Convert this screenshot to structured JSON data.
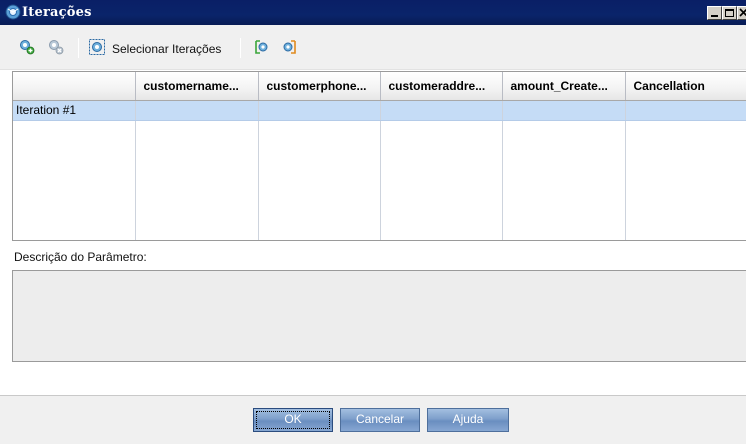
{
  "window": {
    "title": "Iterações",
    "icon": "iterations-icon"
  },
  "toolbar": {
    "icons": [
      "add-iteration-icon",
      "delete-iteration-icon",
      "select-iterations-icon",
      "import-icon",
      "export-icon"
    ],
    "select_label": "Selecionar Iterações"
  },
  "grid": {
    "columns": [
      "",
      "customername...",
      "customerphone...",
      "customeraddre...",
      "amount_Create...",
      "Cancellation"
    ],
    "rows": [
      [
        "Iteration #1",
        "",
        "",
        "",
        "",
        ""
      ]
    ]
  },
  "description": {
    "label": "Descrição do Parâmetro:",
    "value": ""
  },
  "buttons": {
    "ok": "OK",
    "cancel": "Cancelar",
    "help": "Ajuda"
  },
  "colors": {
    "titlebar": "#0a246a",
    "selected_row": "#c5dcf6",
    "button": "#7e9fcb"
  }
}
